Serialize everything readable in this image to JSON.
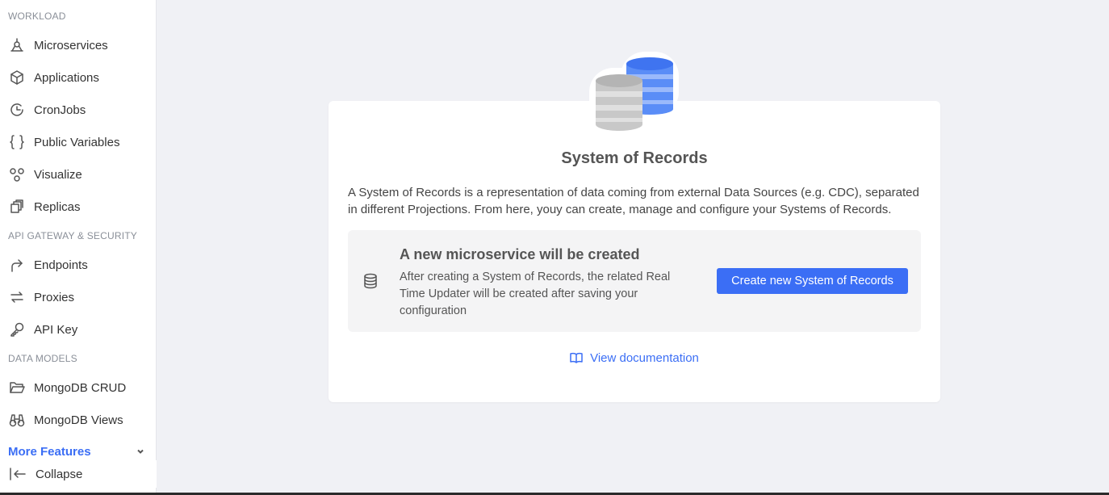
{
  "sidebar": {
    "sections": [
      {
        "title": "WORKLOAD"
      },
      {
        "title": "API GATEWAY & SECURITY"
      },
      {
        "title": "DATA MODELS"
      }
    ],
    "items": [
      {
        "label": "Microservices",
        "icon": "microservices-icon"
      },
      {
        "label": "Applications",
        "icon": "box-icon"
      },
      {
        "label": "CronJobs",
        "icon": "clock-icon"
      },
      {
        "label": "Public Variables",
        "icon": "braces-icon"
      },
      {
        "label": "Visualize",
        "icon": "graph-icon"
      },
      {
        "label": "Replicas",
        "icon": "copy-icon"
      },
      {
        "label": "Endpoints",
        "icon": "endpoint-icon"
      },
      {
        "label": "Proxies",
        "icon": "arrows-swap-icon"
      },
      {
        "label": "API Key",
        "icon": "key-icon"
      },
      {
        "label": "MongoDB CRUD",
        "icon": "folder-icon"
      },
      {
        "label": "MongoDB Views",
        "icon": "binoculars-icon"
      }
    ],
    "more_features": "More Features",
    "collapse": "Collapse"
  },
  "main": {
    "title": "System of Records",
    "description": "A System of Records is a representation of data coming from external Data Sources (e.g. CDC), separated in different Projections. From here, youy can create, manage and configure your Systems of Records.",
    "info": {
      "title": "A new microservice will be created",
      "description": "After creating a System of Records, the related Real Time Updater will be created after saving your configuration",
      "icon": "database-icon"
    },
    "create_button": "Create new System of Records",
    "doc_link": "View documentation"
  },
  "colors": {
    "accent": "#3b6ef5",
    "background": "#f0f1f5"
  }
}
